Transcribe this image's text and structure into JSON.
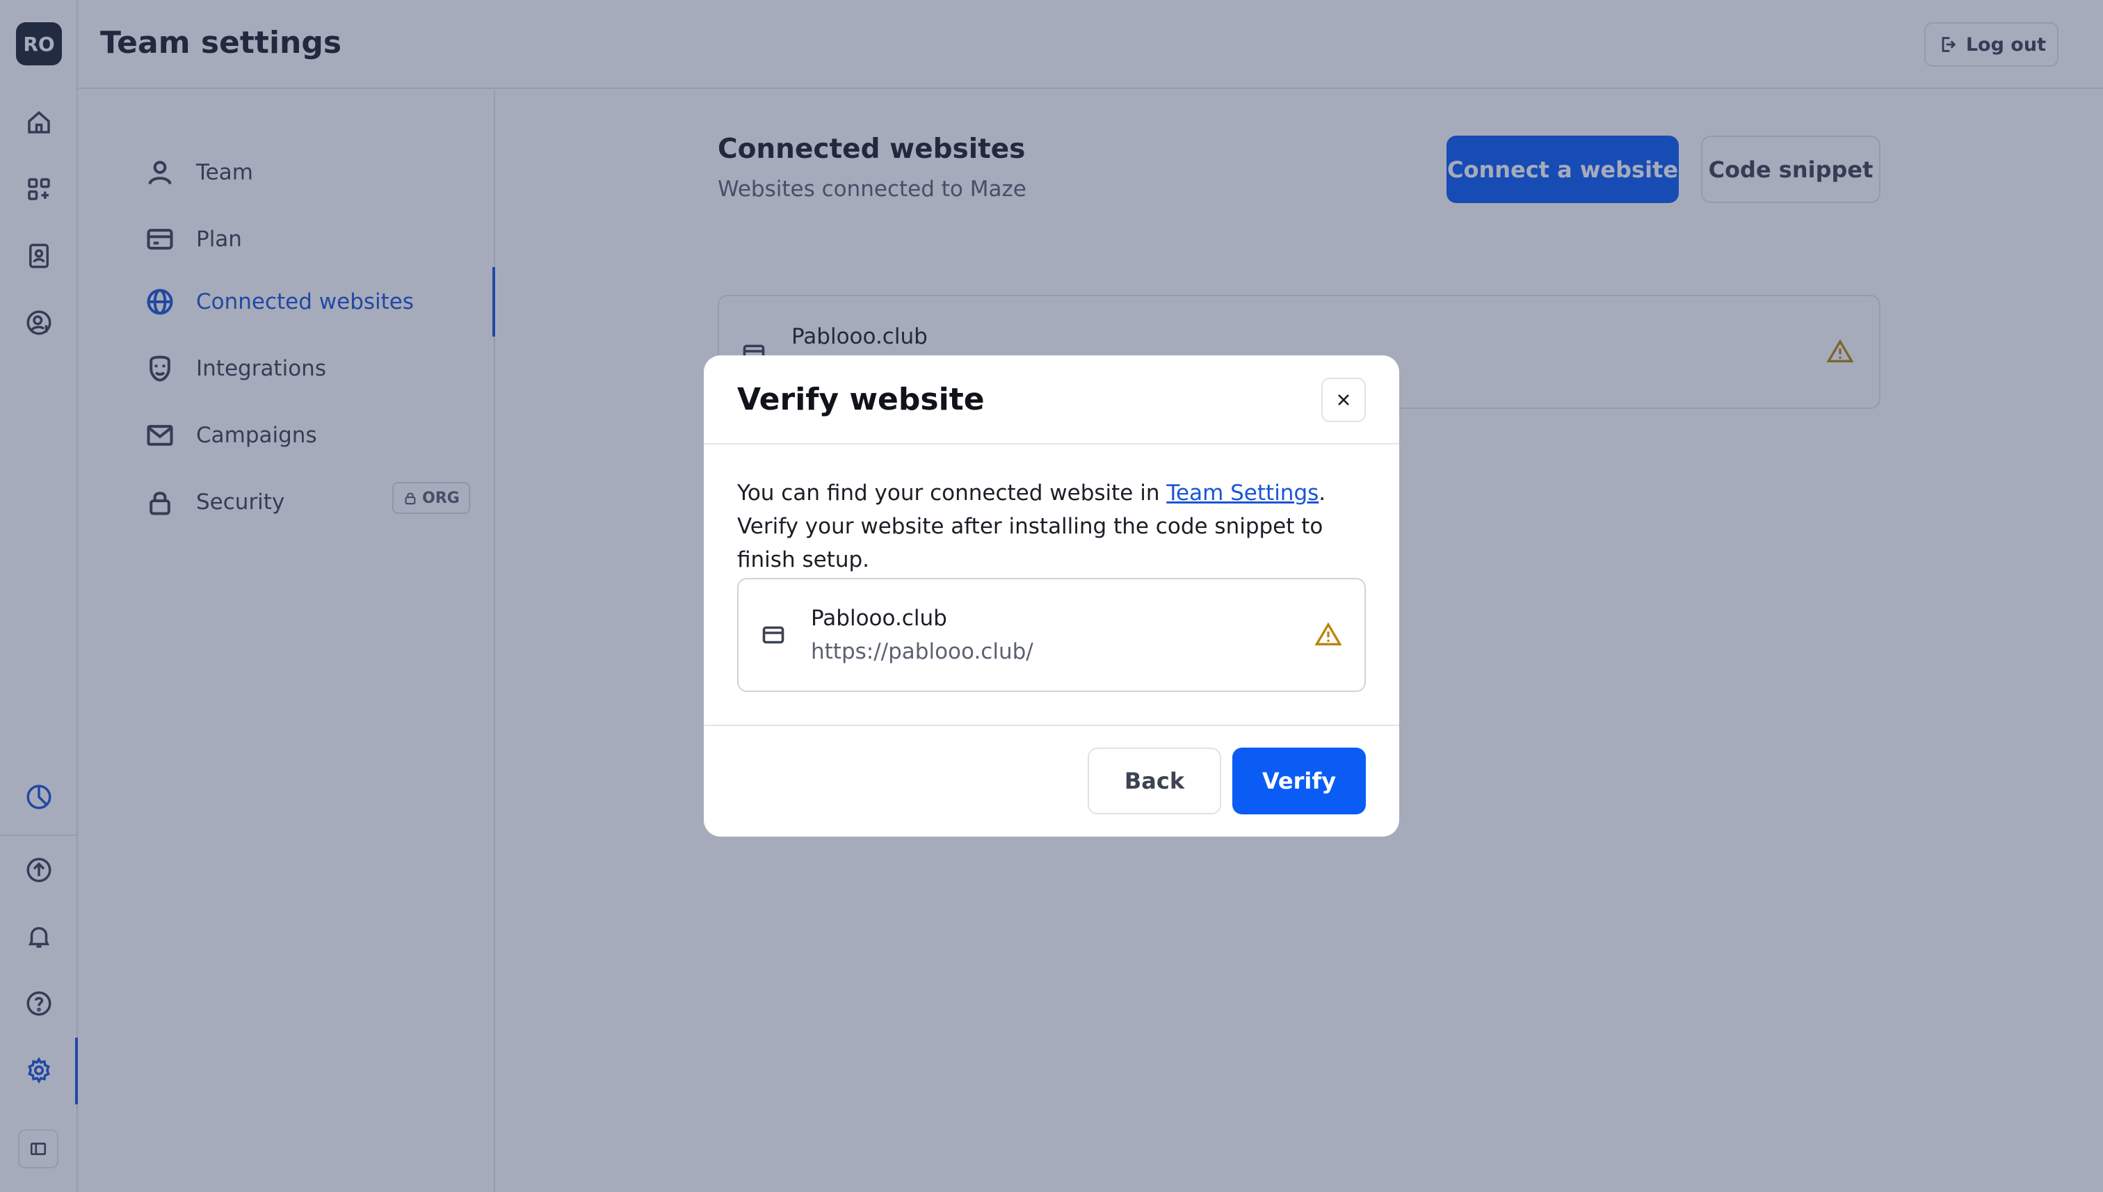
{
  "user": {
    "initials": "RO"
  },
  "header": {
    "title": "Team settings",
    "logout_label": "Log out"
  },
  "rail": {
    "top_icons": [
      "home-icon",
      "apps-icon",
      "contacts-icon",
      "user-dollar-icon"
    ],
    "bottom_icons": [
      "usage-pie-icon",
      "upgrade-arrow-icon",
      "bell-icon",
      "help-icon",
      "settings-gear-icon"
    ]
  },
  "settings_nav": {
    "items": [
      {
        "label": "Team",
        "icon": "person-icon"
      },
      {
        "label": "Plan",
        "icon": "card-icon"
      },
      {
        "label": "Connected websites",
        "icon": "globe-icon",
        "active": true
      },
      {
        "label": "Integrations",
        "icon": "plug-icon"
      },
      {
        "label": "Campaigns",
        "icon": "mail-icon"
      },
      {
        "label": "Security",
        "icon": "lock-icon",
        "badge": "ORG"
      }
    ]
  },
  "main": {
    "title": "Connected websites",
    "subtitle": "Websites connected to Maze",
    "connect_label": "Connect a website",
    "snippet_label": "Code snippet",
    "site": {
      "name": "Pablooo.club"
    }
  },
  "modal": {
    "title": "Verify website",
    "body_before_link": "You can find your connected website in ",
    "body_link": "Team Settings",
    "body_after_link": ". Verify your website after installing the code snippet to finish setup.",
    "site": {
      "name": "Pablooo.club",
      "url": "https://pablooo.club/"
    },
    "back_label": "Back",
    "verify_label": "Verify"
  },
  "colors": {
    "accent": "#0a5cf5",
    "active_nav": "#1a55d6",
    "warning": "#b7860b",
    "overlay": "rgba(44,55,92,0.42)"
  }
}
